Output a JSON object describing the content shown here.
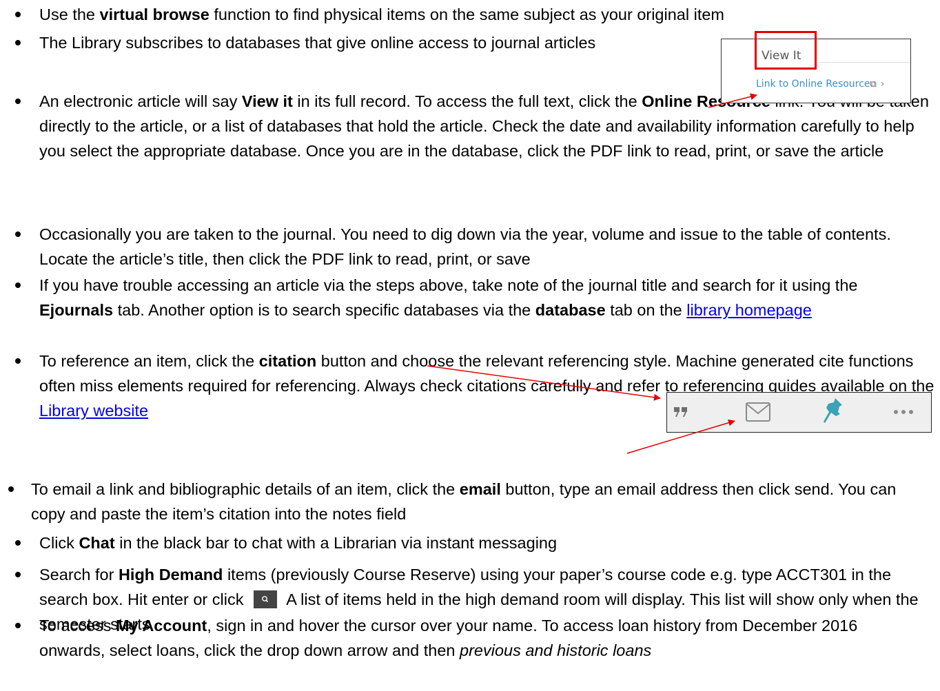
{
  "bullets": [
    {
      "segments": [
        {
          "t": "Use the "
        },
        {
          "t": "virtual browse",
          "b": true
        },
        {
          "t": " function to find physical items on the same subject as your original item"
        }
      ]
    },
    {
      "segments": [
        {
          "t": "The Library subscribes to databases that give online access to journal articles"
        }
      ]
    },
    {
      "segments": [
        {
          "t": "An electronic article will say "
        },
        {
          "t": "View it",
          "b": true
        },
        {
          "t": " in its full record. To access the full text, click the "
        },
        {
          "t": "Online Resource",
          "b": true
        },
        {
          "t": " link. You will be taken directly to the article, or a list of databases that hold the article. Check the date and availability information carefully to help you select the appropriate database. Once you are in the database, click the PDF link to read, print, or save the article"
        }
      ]
    },
    {
      "segments": [
        {
          "t": "Occasionally you are taken to the journal. You need to dig down via the year, volume and issue to the table of contents. Locate the article’s title, then click the PDF link to read, print, or save"
        }
      ]
    },
    {
      "segments": [
        {
          "t": "If you have trouble accessing an article via the steps above, take note of the journal title and search for it using the "
        },
        {
          "t": "Ejournals",
          "b": true
        },
        {
          "t": " tab. Another option is to search specific databases via the "
        },
        {
          "t": "database",
          "b": true
        },
        {
          "t": " tab on the "
        },
        {
          "t": "library homepage",
          "link": true
        }
      ]
    },
    {
      "segments": [
        {
          "t": "To reference an item, click the "
        },
        {
          "t": "citation",
          "b": true
        },
        {
          "t": " button and choose the relevant referencing style. Machine generated cite functions often miss elements required for referencing. Always check citations carefully and refer to referencing guides available on the "
        },
        {
          "t": "Library website",
          "link": true
        }
      ]
    },
    {
      "segments": [
        {
          "t": "To email a link and bibliographic details of an item, click the "
        },
        {
          "t": "email",
          "b": true
        },
        {
          "t": " button, type an email address then click send. You can copy and paste the item’s citation into the notes field"
        }
      ]
    },
    {
      "segments": [
        {
          "t": "Click "
        },
        {
          "t": "Chat",
          "b": true
        },
        {
          "t": " in the black bar to chat with a Librarian via instant messaging"
        }
      ]
    },
    {
      "segments": [
        {
          "t": "Search for "
        },
        {
          "t": "High Demand",
          "b": true
        },
        {
          "t": " items (previously Course Reserve) using your paper’s course code e.g. type ACCT301 in the search box. Hit enter or click "
        },
        {
          "icon": "search-button-icon"
        },
        {
          "t": " A list of items held in the high demand room will display. This list will show only when the semester starts"
        }
      ]
    },
    {
      "segments": [
        {
          "t": "To access "
        },
        {
          "t": "My Account",
          "b": true
        },
        {
          "t": ", sign in and hover the cursor over your name. To access loan history from December 2016 onwards, select loans, click the drop down arrow and then "
        },
        {
          "t": "previous and historic loans",
          "i": true
        }
      ]
    }
  ],
  "viewit": {
    "title": "View It",
    "link": "Link to Online Resource",
    "ext_glyph": "⧉",
    "chevron": "›"
  },
  "actions": [
    {
      "icon": "citation-icon"
    },
    {
      "icon": "email-icon"
    },
    {
      "icon": "pin-icon"
    },
    {
      "icon": "more-icon"
    }
  ],
  "colors": {
    "link": "#0000ee",
    "highlight": "#e50000",
    "pin": "#3aa3b5",
    "online_link": "#3a8ec7"
  }
}
